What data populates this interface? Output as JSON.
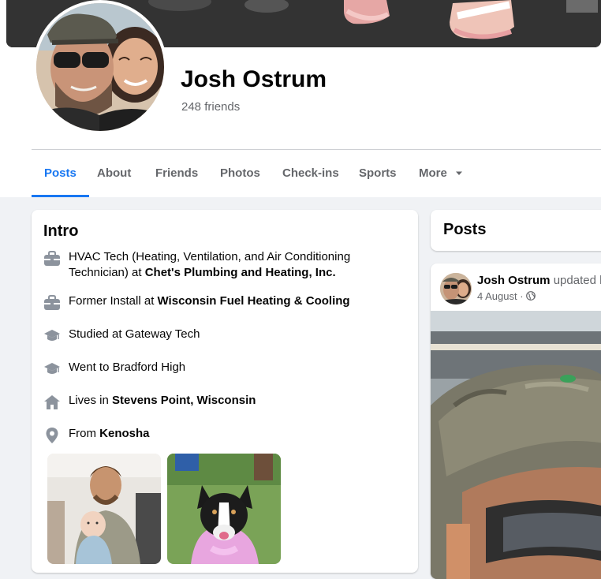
{
  "profile": {
    "name": "Josh Ostrum",
    "friends_count": "248 friends"
  },
  "tabs": [
    {
      "label": "Posts",
      "active": true
    },
    {
      "label": "About"
    },
    {
      "label": "Friends"
    },
    {
      "label": "Photos"
    },
    {
      "label": "Check-ins"
    },
    {
      "label": "Sports"
    },
    {
      "label": "More"
    }
  ],
  "intro": {
    "title": "Intro",
    "items": [
      {
        "icon": "briefcase-icon",
        "prefix": "HVAC Tech (Heating, Ventilation, and Air Conditioning Technician) at ",
        "bold": "Chet's Plumbing and Heating, Inc."
      },
      {
        "icon": "briefcase-icon",
        "prefix": "Former Install at ",
        "bold": "Wisconsin Fuel Heating & Cooling"
      },
      {
        "icon": "graduation-cap-icon",
        "prefix": "Studied at Gateway Tech",
        "bold": ""
      },
      {
        "icon": "graduation-cap-icon",
        "prefix": "Went to Bradford High",
        "bold": ""
      },
      {
        "icon": "home-icon",
        "prefix": "Lives in ",
        "bold": "Stevens Point, Wisconsin"
      },
      {
        "icon": "location-pin-icon",
        "prefix": "From ",
        "bold": "Kenosha"
      }
    ]
  },
  "posts": {
    "title": "Posts",
    "post": {
      "author": "Josh Ostrum",
      "action": "updated h",
      "date": "4 August",
      "separator": "·",
      "audience_icon": "globe-icon"
    }
  },
  "colors": {
    "accent": "#1877f2",
    "background": "#f0f2f5",
    "secondary_text": "#65676b"
  }
}
